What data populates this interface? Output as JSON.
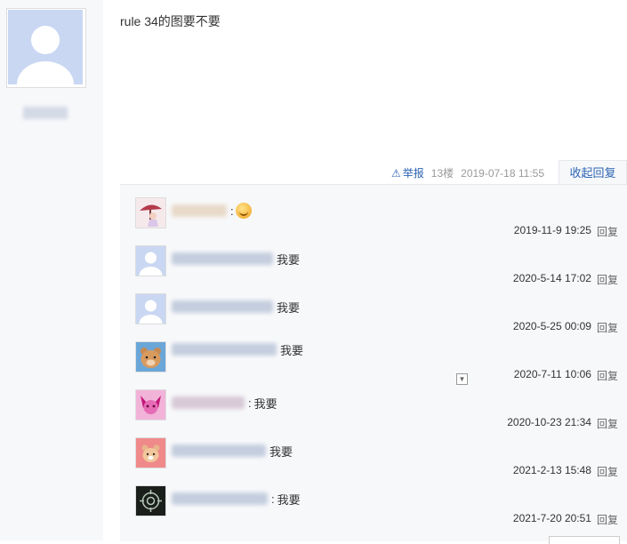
{
  "post": {
    "text": "rule 34的图要不要",
    "report_label": "举报",
    "floor": "13楼",
    "time": "2019-07-18 11:55",
    "collapse_label": "收起回复"
  },
  "replies": [
    {
      "sep": ":",
      "text": "",
      "emoji": "smile-emoji",
      "time": "2019-11-9 19:25",
      "reply_label": "回复",
      "avatar_color": "#f3d6dc"
    },
    {
      "sep": "",
      "text": "我要",
      "time": "2020-5-14 17:02",
      "reply_label": "回复",
      "avatar_color": "#c9d7f2"
    },
    {
      "sep": "",
      "text": "我要",
      "time": "2020-5-25 00:09",
      "reply_label": "回复",
      "avatar_color": "#c9d7f2"
    },
    {
      "sep": "",
      "text": "我要",
      "time": "2020-7-11 10:06",
      "reply_label": "回复",
      "avatar_color": "#6aa6d8"
    },
    {
      "sep": ":",
      "text": "我要",
      "time": "2020-10-23 21:34",
      "reply_label": "回复",
      "avatar_color": "#e56bb5"
    },
    {
      "sep": "",
      "text": "我要",
      "time": "2021-2-13 15:48",
      "reply_label": "回复",
      "avatar_color": "#f08a8a"
    },
    {
      "sep": ":",
      "text": "我要",
      "time": "2021-7-20 20:51",
      "reply_label": "回复",
      "avatar_color": "#1a1f1c"
    }
  ]
}
